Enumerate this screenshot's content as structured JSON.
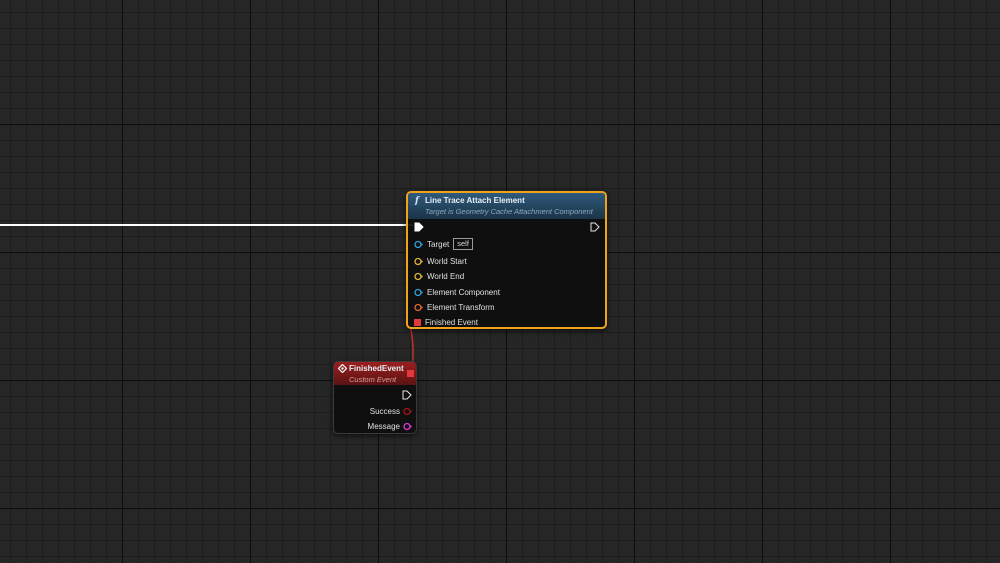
{
  "nodes": {
    "line_trace": {
      "title": "Line Trace Attach Element",
      "subtitle": "Target is Geometry Cache Attachment Component",
      "func_icon": "f",
      "pins": {
        "target_label": "Target",
        "target_value": "self",
        "world_start": "World Start",
        "world_end": "World End",
        "element_component": "Element Component",
        "element_transform": "Element Transform",
        "finished_event": "Finished Event"
      }
    },
    "finished_event": {
      "title": "FinishedEvent",
      "subtitle": "Custom Event",
      "pins": {
        "success": "Success",
        "message": "Message"
      }
    }
  },
  "colors": {
    "selection_border": "#f0a31a",
    "function_header": "#2f5b7d",
    "event_header": "#9b1f1f",
    "object_pin": "#2e9ed8",
    "vector_pin": "#e2b43a",
    "transform_pin": "#e0672a",
    "delegate_pin": "#e23a3a",
    "bool_pin": "#a31414",
    "string_pin": "#d838d8",
    "exec_pin": "#ffffff",
    "delegate_wire": "#c23030"
  },
  "icons": {
    "exec_in": "exec-in-icon",
    "exec_out": "exec-out-icon",
    "event": "event-diamond-icon",
    "delegate": "delegate-square-icon"
  }
}
